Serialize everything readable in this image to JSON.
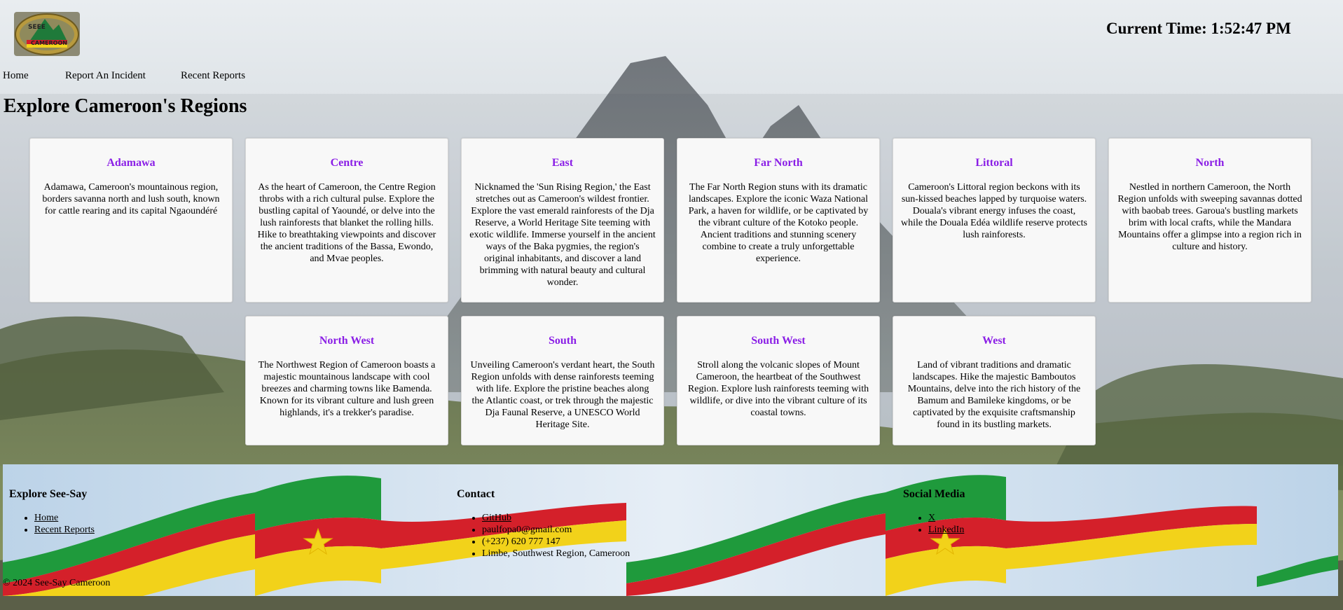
{
  "header": {
    "logo_text_top": "SEEE",
    "logo_text_bottom": "CAMEROON",
    "clock_label": "Current Time: 1:52:47 PM"
  },
  "nav": {
    "items": [
      "Home",
      "Report An Incident",
      "Recent Reports"
    ]
  },
  "main": {
    "title": "Explore Cameroon's Regions",
    "regions": [
      {
        "name": "Adamawa",
        "text": "Adamawa, Cameroon's mountainous region, borders savanna north and lush south, known for cattle rearing and its capital Ngaoundéré"
      },
      {
        "name": "Centre",
        "text": "As the heart of Cameroon, the Centre Region throbs with a rich cultural pulse. Explore the bustling capital of Yaoundé, or delve into the lush rainforests that blanket the rolling hills. Hike to breathtaking viewpoints and discover the ancient traditions of the Bassa, Ewondo, and Mvae peoples."
      },
      {
        "name": "East",
        "text": "Nicknamed the 'Sun Rising Region,' the East stretches out as Cameroon's wildest frontier. Explore the vast emerald rainforests of the Dja Reserve, a World Heritage Site teeming with exotic wildlife. Immerse yourself in the ancient ways of the Baka pygmies, the region's original inhabitants, and discover a land brimming with natural beauty and cultural wonder."
      },
      {
        "name": "Far North",
        "text": "The Far North Region stuns with its dramatic landscapes. Explore the iconic Waza National Park, a haven for wildlife, or be captivated by the vibrant culture of the Kotoko people. Ancient traditions and stunning scenery combine to create a truly unforgettable experience."
      },
      {
        "name": "Littoral",
        "text": "Cameroon's Littoral region beckons with its sun-kissed beaches lapped by turquoise waters. Douala's vibrant energy infuses the coast, while the Douala Edéa wildlife reserve protects lush rainforests."
      },
      {
        "name": "North",
        "text": "Nestled in northern Cameroon, the North Region unfolds with sweeping savannas dotted with baobab trees. Garoua's bustling markets brim with local crafts, while the Mandara Mountains offer a glimpse into a region rich in culture and history."
      },
      {
        "name": "North West",
        "text": "The Northwest Region of Cameroon boasts a majestic mountainous landscape with cool breezes and charming towns like Bamenda. Known for its vibrant culture and lush green highlands, it's a trekker's paradise."
      },
      {
        "name": "South",
        "text": "Unveiling Cameroon's verdant heart, the South Region unfolds with dense rainforests teeming with life. Explore the pristine beaches along the Atlantic coast, or trek through the majestic Dja Faunal Reserve, a UNESCO World Heritage Site."
      },
      {
        "name": "South West",
        "text": "Stroll along the volcanic slopes of Mount Cameroon, the heartbeat of the Southwest Region. Explore lush rainforests teeming with wildlife, or dive into the vibrant culture of its coastal towns."
      },
      {
        "name": "West",
        "text": "Land of vibrant traditions and dramatic landscapes. Hike the majestic Bamboutos Mountains, delve into the rich history of the Bamum and Bamileke kingdoms, or be captivated by the exquisite craftsmanship found in its bustling markets."
      }
    ]
  },
  "footer": {
    "explore": {
      "title": "Explore See-Say",
      "links": [
        "Home",
        "Recent Reports"
      ]
    },
    "contact": {
      "title": "Contact",
      "items": [
        "GitHub",
        "paulfopa0@gmail.com",
        "(+237) 620 777 147",
        "Limbe, Southwest Region, Cameroon"
      ]
    },
    "social": {
      "title": "Social Media",
      "links": [
        "X",
        "LinkedIn"
      ]
    },
    "copyright": "© 2024 See-Say Cameroon"
  },
  "colors": {
    "region_title": "#8a1ee6",
    "flag_green": "#1f9a3c",
    "flag_red": "#d4202a",
    "flag_yellow": "#f2d21a"
  }
}
